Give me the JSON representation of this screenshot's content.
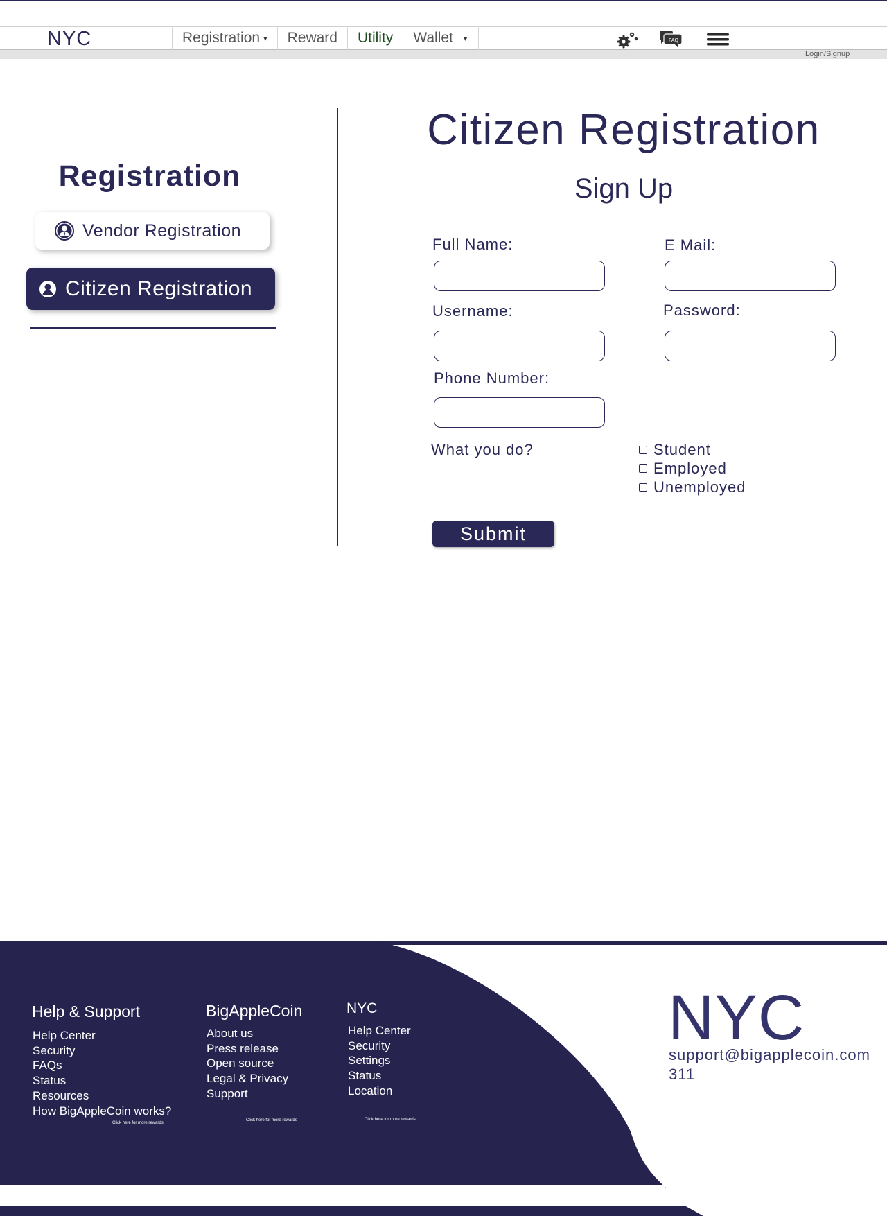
{
  "header": {
    "brand": "NYC",
    "nav": [
      {
        "label": "Registration",
        "caret": "▾"
      },
      {
        "label": "Reward"
      },
      {
        "label": "Utility"
      },
      {
        "label": "Wallet",
        "caret": "▾"
      }
    ],
    "icons": [
      "settings-gears-icon",
      "faq-chat-icon",
      "hamburger-menu-icon"
    ],
    "faq_icon_text": "FAQ",
    "login_label": "Login/Signup"
  },
  "sidebar": {
    "title": "Registration",
    "items": [
      {
        "label": "Vendor Registration",
        "icon": "vendor-user-icon",
        "active": false
      },
      {
        "label": "Citizen Registration",
        "icon": "citizen-user-icon",
        "active": true
      }
    ]
  },
  "form": {
    "title": "Citizen Registration",
    "subtitle": "Sign Up",
    "fields": {
      "full_name": {
        "label": "Full Name:",
        "value": ""
      },
      "email": {
        "label": "E Mail:",
        "value": ""
      },
      "username": {
        "label": "Username:",
        "value": ""
      },
      "password": {
        "label": "Password:",
        "value": ""
      },
      "phone": {
        "label": "Phone Number:",
        "value": ""
      }
    },
    "occupation_question": "What you do?",
    "occupation_options": [
      "Student",
      "Employed",
      "Unemployed"
    ],
    "submit_label": "Submit"
  },
  "footer": {
    "columns": [
      {
        "heading": "Help & Support",
        "links": [
          "Help Center",
          "Security",
          "FAQs",
          "Status",
          "Resources",
          "How BigAppleCoin works?"
        ],
        "more": "Click here for more rewards"
      },
      {
        "heading": "BigAppleCoin",
        "links": [
          "About us",
          "Press release",
          "Open source",
          "Legal & Privacy",
          "Support"
        ],
        "more": "Click here for more rewards"
      },
      {
        "heading": "NYC",
        "links": [
          "Help Center",
          "Security",
          "Settings",
          "Status",
          "Location"
        ],
        "more": "Click here for more rewards"
      }
    ],
    "brand": "NYC",
    "email": "support@bigapplecoin.com",
    "phone": "311"
  },
  "colors": {
    "primary": "#2a2857",
    "footer_dark": "#26244f",
    "nav_active": "#1f4d1f"
  }
}
